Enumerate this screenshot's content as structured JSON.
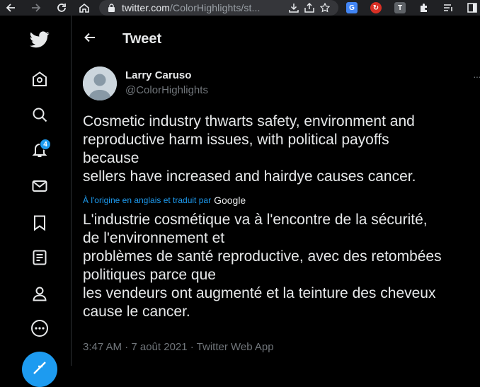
{
  "browser": {
    "url_host": "twitter.com",
    "url_path": "/ColorHighlights/st...",
    "extensions": [
      {
        "name": "google-translate-extension",
        "color": "#4285f4",
        "label": "G"
      },
      {
        "name": "red-extension",
        "color": "#d93025",
        "label": "↻"
      },
      {
        "name": "text-extension",
        "color": "#5f6368",
        "label": "T"
      }
    ]
  },
  "nav": {
    "notifications_badge": "4",
    "items": [
      "home",
      "explore",
      "notifications",
      "messages",
      "bookmarks",
      "lists",
      "profile",
      "more"
    ]
  },
  "header": {
    "title": "Tweet"
  },
  "tweet": {
    "author_name": "Larry Caruso",
    "author_handle": "@ColorHighlights",
    "text": "Cosmetic industry thwarts safety, environment and\nreproductive harm issues, with political payoffs\nbecause\nsellers have increased and hairdye causes cancer.",
    "translated_by_label": "À l'origine en anglais et traduit par",
    "translated_by_service": "Google",
    "translation": "L'industrie cosmétique va à l'encontre de la sécurité,\nde l'environnement et\nproblèmes de santé reproductive, avec des retombées\npolitiques parce que\nles vendeurs ont augmenté et la teinture des cheveux\ncause le cancer.",
    "timestamp": "3:47 AM · 7 août 2021 · Twitter Web App"
  },
  "colors": {
    "accent": "#1d9bf0",
    "background": "#000000",
    "text": "#e7e9ea",
    "secondary_text": "#71767b"
  }
}
